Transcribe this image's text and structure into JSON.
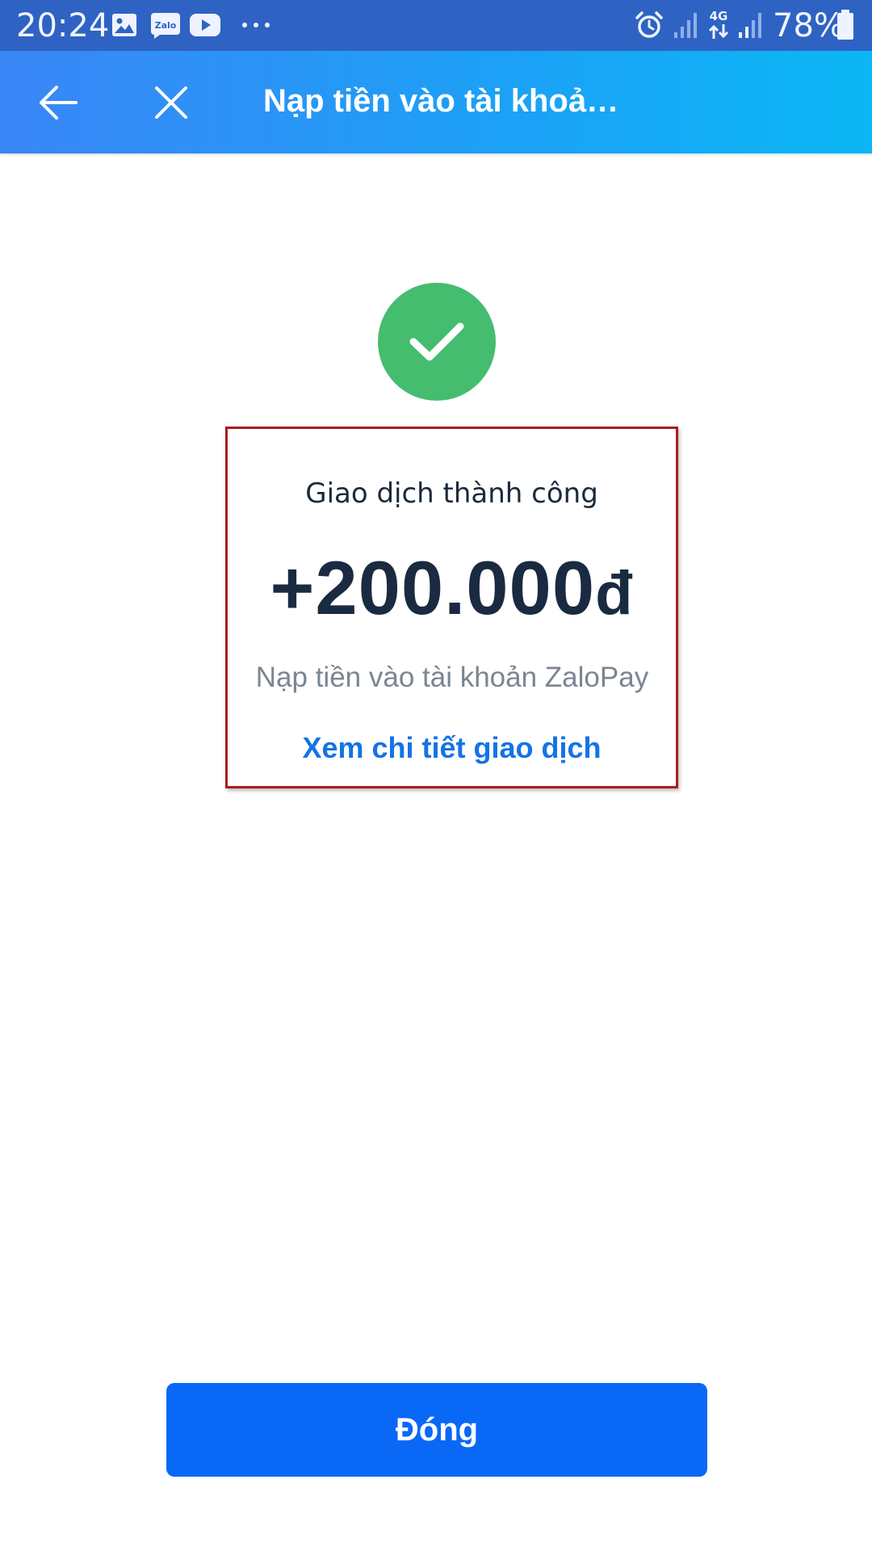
{
  "status_bar": {
    "time": "20:24",
    "battery_percent": "78%",
    "network_label": "4G",
    "notification_icons": [
      "gallery-icon",
      "zalo-icon",
      "youtube-icon",
      "more-dots-icon"
    ],
    "system_icons": [
      "alarm-icon",
      "signal-icon",
      "signal-4g-icon",
      "battery-icon"
    ]
  },
  "header": {
    "title": "Nạp tiền vào tài khoả…",
    "left_icons": [
      "back-arrow-icon",
      "close-icon"
    ],
    "gradient_colors": [
      "#3a86f7",
      "#0bb7f5"
    ]
  },
  "result": {
    "status_text": "Giao dịch thành công",
    "amount": "+200.000",
    "currency": "đ",
    "description": "Nạp tiền vào tài khoản ZaloPay",
    "detail_link": "Xem chi tiết giao dịch",
    "success_color": "#44bd6e"
  },
  "footer": {
    "close_label": "Đóng",
    "button_color": "#0a68f7"
  }
}
